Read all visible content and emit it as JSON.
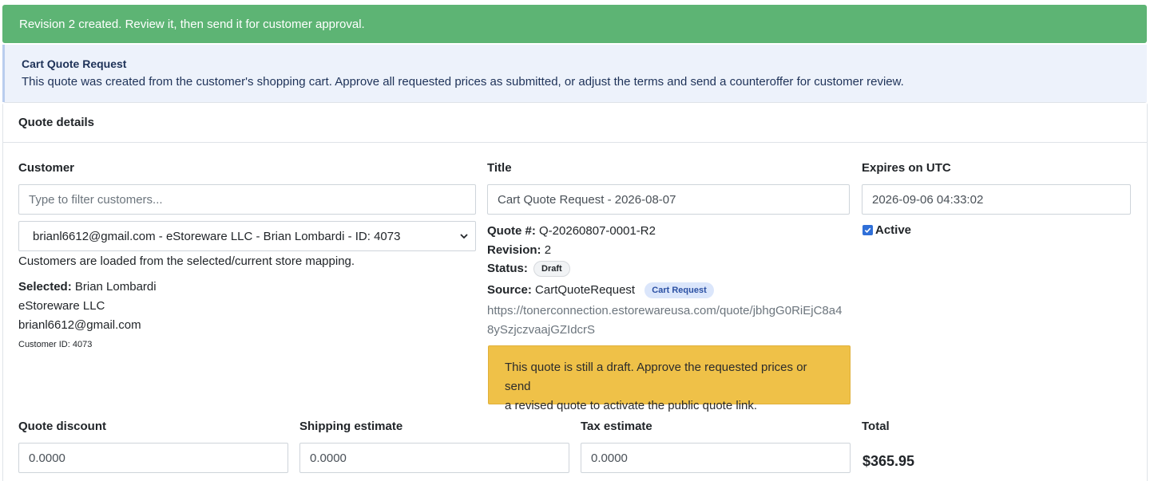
{
  "alert": {
    "text": "Revision 2 created. Review it, then send it for customer approval."
  },
  "info": {
    "title": "Cart Quote Request",
    "text": "This quote was created from the customer's shopping cart. Approve all requested prices as submitted, or adjust the terms and send a counteroffer for customer review."
  },
  "card": {
    "header": "Quote details"
  },
  "customer": {
    "label": "Customer",
    "filter_placeholder": "Type to filter customers...",
    "selected_option": "brianl6612@gmail.com - eStoreware LLC - Brian Lombardi - ID: 4073",
    "help": "Customers are loaded from the selected/current store mapping.",
    "selected_label": "Selected:",
    "selected_name": "Brian Lombardi",
    "company": "eStoreware LLC",
    "email": "brianl6612@gmail.com",
    "customer_id": "Customer ID: 4073"
  },
  "title_field": {
    "label": "Title",
    "value": "Cart Quote Request - 2026-08-07"
  },
  "meta": {
    "quote_label": "Quote #:",
    "quote_value": "Q-20260807-0001-R2",
    "revision_label": "Revision:",
    "revision_value": "2",
    "status_label": "Status:",
    "status_badge": "Draft",
    "source_label": "Source:",
    "source_value": "CartQuoteRequest",
    "source_badge": "Cart Request",
    "url_line1": "https://tonerconnection.estorewareusa.com/quote/jbhgG0RiEjC8a4",
    "url_line2": "8ySzjczvaajGZIdcrS"
  },
  "warning": {
    "line1": "This quote is still a draft. Approve the requested prices or send",
    "line2": "a revised quote to activate the public quote link."
  },
  "expires": {
    "label": "Expires on UTC",
    "value": "2026-09-06 04:33:02",
    "active_label": "Active",
    "active_checked": true
  },
  "amounts": {
    "discount_label": "Quote discount",
    "discount_value": "0.0000",
    "shipping_label": "Shipping estimate",
    "shipping_value": "0.0000",
    "tax_label": "Tax estimate",
    "tax_value": "0.0000",
    "total_label": "Total",
    "total_value": "$365.95"
  },
  "colors": {
    "success": "#5db474",
    "info_bg": "#edf2fb",
    "warning": "#efc148",
    "accent": "#2f6fd8"
  }
}
